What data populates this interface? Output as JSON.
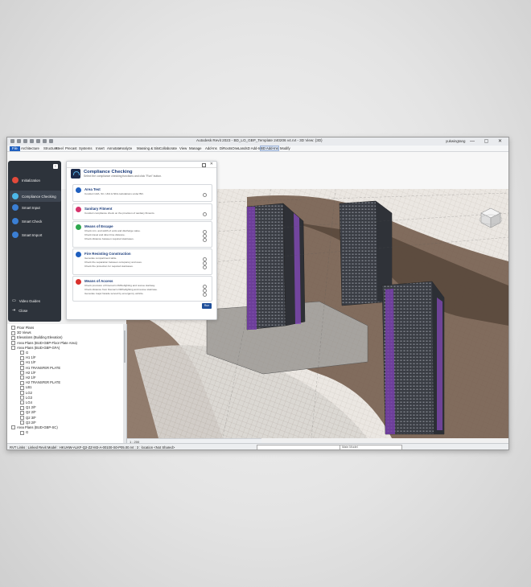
{
  "window": {
    "title": "Autodesk Revit 2023 - BD_LO_GBP_Template 240206 v4.rvt - 3D View: {3D}",
    "user": "yukwingtang",
    "controls": "— ▢ ✕"
  },
  "menu": {
    "tabs": [
      "File",
      "Architecture",
      "Structure",
      "Steel",
      "Precast",
      "Systems",
      "Insert",
      "Annotate",
      "Analyze",
      "Massing & Site",
      "Collaborate",
      "View",
      "Manage",
      "Add-Ins",
      "DiRootsOne",
      "LandsD Add-Ins",
      "BD Add-Ins",
      "Modify"
    ],
    "active_tab": "BD Add-Ins"
  },
  "plugin": {
    "sidebar": {
      "items": [
        {
          "label": "Initialization",
          "icon": "initialization-icon",
          "color": "#e24a3b"
        },
        {
          "label": "Compliance Checking",
          "icon": "compliance-icon",
          "color": "#4db8e8"
        },
        {
          "label": "Smart Input",
          "icon": "smart-input-icon",
          "color": "#3b7fd4"
        },
        {
          "label": "Smart Check",
          "icon": "smart-check-icon",
          "color": "#3b7fd4"
        },
        {
          "label": "Smart Import",
          "icon": "smart-import-icon",
          "color": "#3b7fd4"
        }
      ],
      "video_guides": "Video Guides",
      "close": "Close"
    },
    "main": {
      "title": "Compliance Checking",
      "subtitle": "Select the compliance checking functions and click \"Run\" button.",
      "run_label": "Run",
      "cards": [
        {
          "title": "Area Test",
          "color": "#1f5fbf",
          "lines": [
            "Conduct GFA, SC, UFA & NFA calculations under BD."
          ]
        },
        {
          "title": "Sanitary Fitment",
          "color": "#d6336c",
          "lines": [
            "Conduct compliance check on the provision of sanitary fitments."
          ]
        },
        {
          "title": "Means of Escape",
          "color": "#2fa84f",
          "lines": [
            "Check min. and width of exits and discharge value.",
            "Check travel and direct line distance.",
            "Check distance between required staircases."
          ]
        },
        {
          "title": "Fire Resisting Construction",
          "color": "#1f5fbf",
          "lines": [
            "Generate compartment table.",
            "Check the separation between occupancy and uses.",
            "Check fire protection for required staircases."
          ]
        },
        {
          "title": "Means of Access",
          "color": "#d9302c",
          "lines": [
            "Check provision of Fireman's lift/firefighting and rescue stairway.",
            "Check distance from fireman's lift/firefighting and rescue staircase.",
            "Generate major facade served by emergency vehicle."
          ]
        }
      ]
    }
  },
  "browser": {
    "rows": [
      "Floor Plans",
      "3D Views",
      "Elevations (Building Elevation)",
      "Area Plans (BUD-GBP-Floor Plate Area)",
      "Area Plans (BUD-GBP-GFA)",
      "G",
      "H1 1/F",
      "H1 1/F",
      "H1 TRANSFER PLATE",
      "H2 1/F",
      "H2 1/F",
      "H2 TRANSFER PLATE",
      "LB1",
      "LG2",
      "LG3",
      "LG4",
      "Q1 2/F",
      "Q2 2/F",
      "Q2 3/F",
      "Q3 2/F",
      "Area Plans (BUD-GBP-SC)",
      "G"
    ]
  },
  "view_control": {
    "scale": "1 : 200"
  },
  "status": {
    "text": "RVT Links : Linked Revit Model : HKUHW-ALKF-Q2-ZZ-M3-A-00100-S0-P05.00.rvt : 3 : location <Not Shared>",
    "model": "Main Model"
  }
}
